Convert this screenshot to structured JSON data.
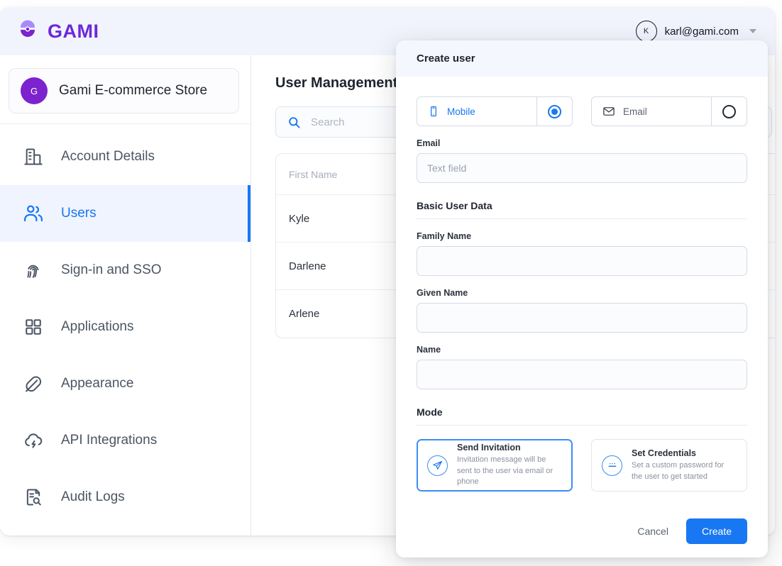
{
  "topbar": {
    "brand_name": "GAMI",
    "brand_icon": "gami-logo-icon",
    "user_email": "karl@gami.com",
    "avatar_initial": "K",
    "caret_icon": "chevron-down-icon"
  },
  "sidebar": {
    "org": {
      "initial": "G",
      "name": "Gami E-commerce Store"
    },
    "items": [
      {
        "label": "Account Details",
        "icon": "building-icon",
        "active": false
      },
      {
        "label": "Users",
        "icon": "users-icon",
        "active": true
      },
      {
        "label": "Sign-in and SSO",
        "icon": "fingerprint-icon",
        "active": false
      },
      {
        "label": "Applications",
        "icon": "grid-icon",
        "active": false
      },
      {
        "label": "Appearance",
        "icon": "feather-icon",
        "active": false
      },
      {
        "label": "API Integrations",
        "icon": "cloud-lightning-icon",
        "active": false
      },
      {
        "label": "Audit Logs",
        "icon": "document-search-icon",
        "active": false
      }
    ]
  },
  "main": {
    "page_title": "User Management",
    "search": {
      "placeholder": "Search",
      "icon": "search-icon"
    },
    "table": {
      "columns": [
        "First Name"
      ],
      "rows": [
        {
          "first_name": "Kyle"
        },
        {
          "first_name": "Darlene"
        },
        {
          "first_name": "Arlene"
        }
      ]
    }
  },
  "modal": {
    "title": "Create user",
    "identifier_options": [
      {
        "label": "Mobile",
        "icon": "mobile-icon",
        "selected": true
      },
      {
        "label": "Email",
        "icon": "envelope-icon",
        "selected": false
      }
    ],
    "email_field": {
      "label": "Email",
      "placeholder": "Text field",
      "value": ""
    },
    "basic_section_title": "Basic User Data",
    "fields": [
      {
        "label": "Family Name",
        "value": "",
        "placeholder": ""
      },
      {
        "label": "Given Name",
        "value": "",
        "placeholder": ""
      },
      {
        "label": "Name",
        "value": "",
        "placeholder": ""
      }
    ],
    "mode_section_title": "Mode",
    "modes": [
      {
        "title": "Send Invitation",
        "desc": "Invitation message will be sent to the user via email or phone",
        "icon": "send-icon",
        "selected": true
      },
      {
        "title": "Set Credentials",
        "desc": "Set a custom password for the user to get started",
        "icon": "password-icon",
        "selected": false
      }
    ],
    "cancel_label": "Cancel",
    "create_label": "Create"
  },
  "colors": {
    "brand_purple": "#6d28d9",
    "org_purple": "#7c22ce",
    "accent_blue": "#1877f2",
    "topbar_bg": "#f2f4fd",
    "active_nav_bg": "#f0f4ff"
  }
}
